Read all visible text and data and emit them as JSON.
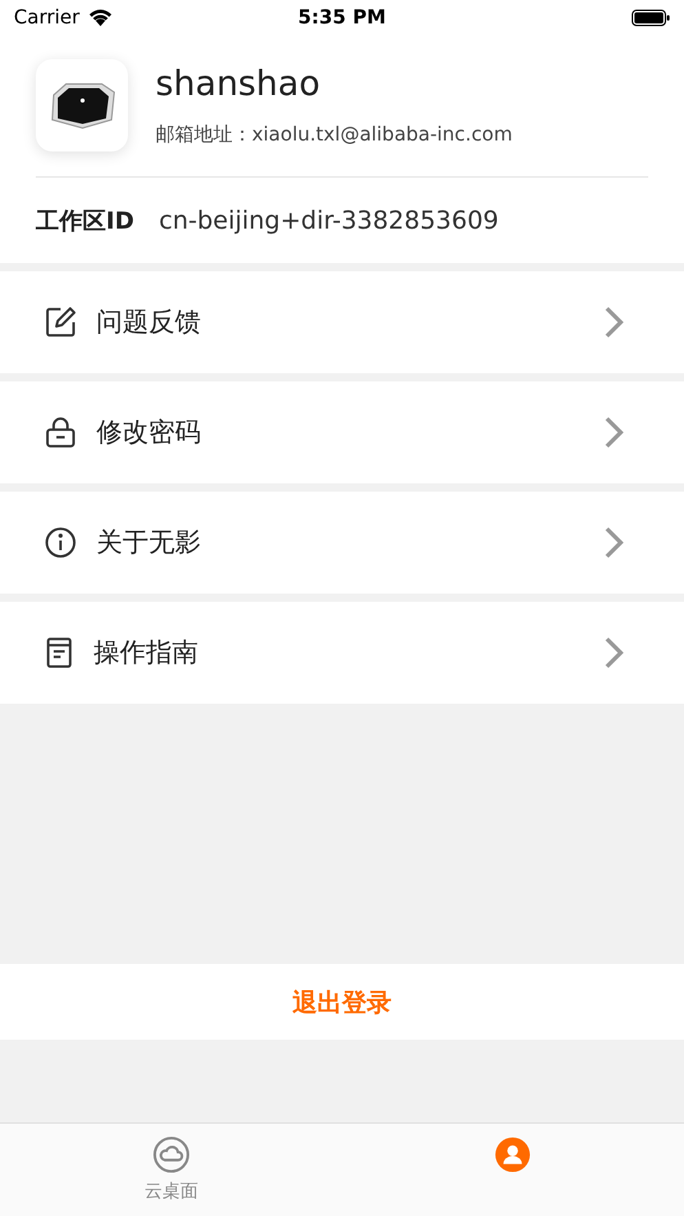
{
  "status_bar": {
    "carrier": "Carrier",
    "time": "5:35 PM"
  },
  "profile": {
    "name": "shanshao",
    "email_label": "邮箱地址：",
    "email": "xiaolu.txl@alibaba-inc.com"
  },
  "workspace": {
    "label": "工作区ID",
    "value": "cn-beijing+dir-3382853609"
  },
  "menu": [
    {
      "kind": "feedback",
      "label": "问题反馈"
    },
    {
      "kind": "password",
      "label": "修改密码"
    },
    {
      "kind": "about",
      "label": "关于无影"
    },
    {
      "kind": "guide",
      "label": "操作指南"
    }
  ],
  "logout": "退出登录",
  "tab_bar": [
    {
      "kind": "desktop",
      "label": "云桌面",
      "selected": false
    },
    {
      "kind": "account",
      "selected": true
    }
  ]
}
